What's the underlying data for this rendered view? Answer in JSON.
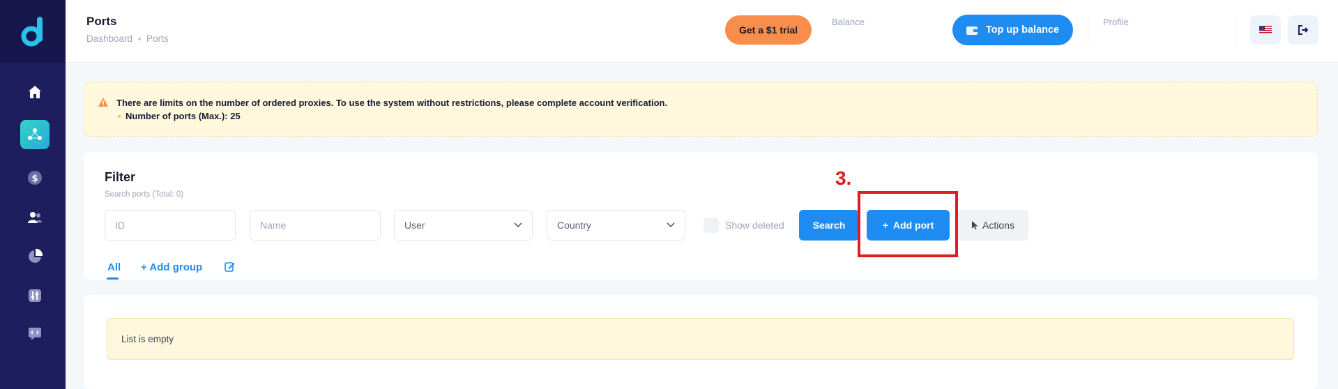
{
  "header": {
    "title": "Ports",
    "breadcrumb": [
      "Dashboard",
      "Ports"
    ],
    "trial_button": "Get a $1 trial",
    "balance_label": "Balance",
    "topup_button": "Top up balance",
    "profile_label": "Profile"
  },
  "sidebar": {
    "items": [
      {
        "name": "home-icon",
        "active": false
      },
      {
        "name": "network-icon",
        "active": true
      },
      {
        "name": "dollar-icon",
        "active": false
      },
      {
        "name": "users-icon",
        "active": false
      },
      {
        "name": "chart-pie-icon",
        "active": false
      },
      {
        "name": "settings-sliders-icon",
        "active": false
      },
      {
        "name": "code-chat-icon",
        "active": false
      }
    ]
  },
  "warning": {
    "message": "There are limits on the number of ordered proxies. To use the system without restrictions, please complete account verification.",
    "item": "Number of ports (Max.): 25"
  },
  "filter": {
    "title": "Filter",
    "subtitle": "Search ports (Total: 0)",
    "id_placeholder": "ID",
    "name_placeholder": "Name",
    "user_select": "User",
    "country_select": "Country",
    "show_deleted": "Show deleted",
    "search_button": "Search",
    "add_port_button": "Add port",
    "actions_button": "Actions"
  },
  "tabs": {
    "all": "All",
    "add_group": "Add group"
  },
  "annotation": {
    "label": "3."
  },
  "list": {
    "empty_message": "List is empty"
  },
  "colors": {
    "primary": "#1e8cf0",
    "trial": "#f98d4c",
    "sidebar": "#1e1e5e",
    "annotation": "#e11b22",
    "warning_bg": "#fff8dd"
  }
}
